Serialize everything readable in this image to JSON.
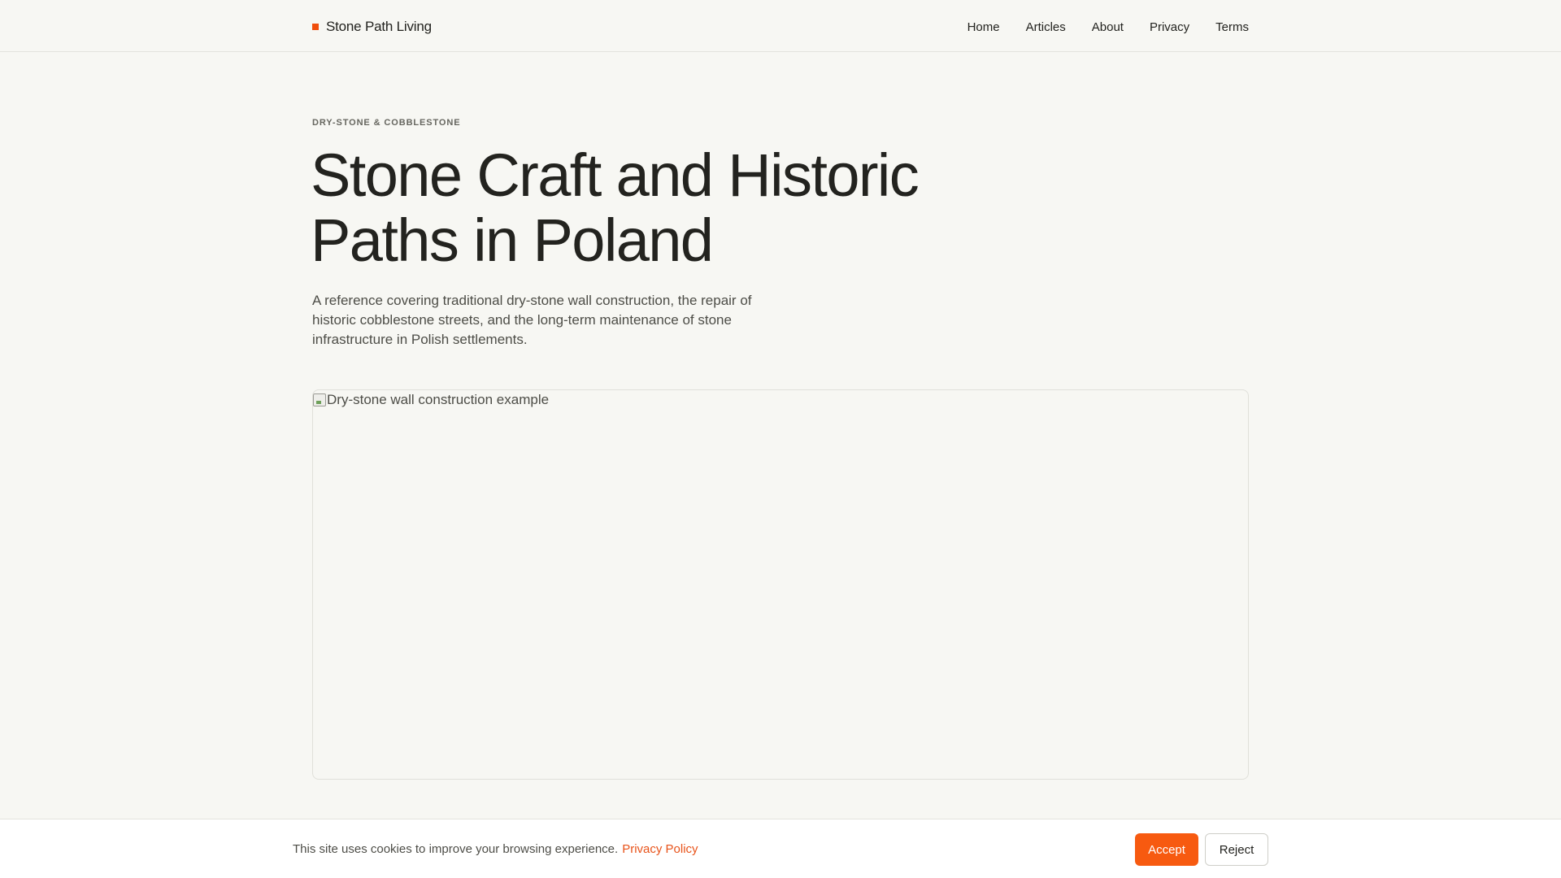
{
  "header": {
    "brand": "Stone Path Living",
    "brand_mark_color": "#f04e0c",
    "nav": [
      "Home",
      "Articles",
      "About",
      "Privacy",
      "Terms"
    ]
  },
  "hero": {
    "eyebrow": "DRY-STONE & COBBLESTONE",
    "title": "Stone Craft and Historic Paths in Poland",
    "lede": "A reference covering traditional dry-stone wall construction, the repair of historic cobblestone streets, and the long-term maintenance of stone infrastructure in Polish settlements.",
    "image_alt": "Dry-stone wall construction example",
    "image_icon": "broken-image-icon"
  },
  "cookie_banner": {
    "text": "This site uses cookies to improve your browsing experience.",
    "link": "Privacy Policy",
    "accept": "Accept",
    "reject": "Reject",
    "accent_color": "#f75a10"
  }
}
